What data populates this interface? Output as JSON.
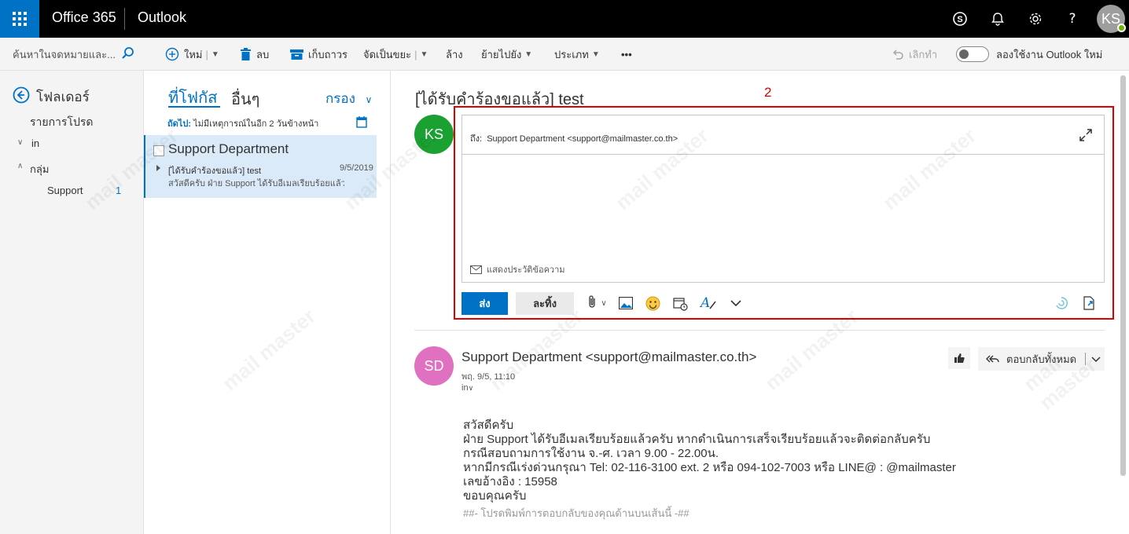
{
  "topbar": {
    "brand": "Office 365",
    "app": "Outlook",
    "avatar_initials": "KS",
    "icons": [
      "waffle-icon",
      "skype-icon",
      "bell-icon",
      "gear-icon",
      "help-icon"
    ],
    "help_glyph": "?"
  },
  "search": {
    "placeholder": "ค้นหาในจดหมายและ..."
  },
  "toolbar": {
    "new": "ใหม่",
    "delete": "ลบ",
    "archive": "เก็บถาวร",
    "junk": "จัดเป็นขยะ",
    "sweep": "ล้าง",
    "move": "ย้ายไปยัง",
    "categorize": "ประเภท",
    "more": "•••",
    "undo": "เลิกทำ",
    "try_new": "ลองใช้งาน Outlook ใหม่"
  },
  "folders": {
    "header": "โฟลเดอร์",
    "favorites": "รายการโปรด",
    "inbox": "in",
    "groups": "กลุ่ม",
    "group_items": [
      {
        "label": "Support",
        "count": "1"
      }
    ]
  },
  "message_list": {
    "tab_focused": "ที่โฟกัส",
    "tab_other": "อื่นๆ",
    "filter": "กรอง",
    "next_label": "ถัดไป:",
    "next_text": "ไม่มีเหตุการณ์ในอีก 2 วันข้างหน้า",
    "items": [
      {
        "sender": "Support Department",
        "subject": "[ได้รับคำร้องขอแล้ว] test",
        "date": "9/5/2019",
        "preview": "สวัสดีครับ  ฝ่าย Support ได้รับอีเมลเรียบร้อยแล้วครับ"
      }
    ]
  },
  "reading": {
    "subject": "[ได้รับคำร้องขอแล้ว] test",
    "annotation_number": "2",
    "compose": {
      "avatar_initials": "KS",
      "to_label": "ถึง:",
      "to_value": "Support Department <support@mailmaster.co.th>",
      "show_history": "แสดงประวัติข้อความ",
      "send": "ส่ง",
      "discard": "ละทิ้ง"
    },
    "message": {
      "avatar_initials": "SD",
      "from": "Support Department <support@mailmaster.co.th>",
      "date": "พฤ. 9/5, 11:10",
      "folder": "in",
      "reply_all": "ตอบกลับทั้งหมด",
      "body": "สวัสดีครับ\nฝ่าย Support ได้รับอีเมลเรียบร้อยแล้วครับ หากดำเนินการเสร็จเรียบร้อยแล้วจะติดต่อกลับครับ\nกรณีสอบถามการใช้งาน จ.-ศ. เวลา 9.00 - 22.00น.\nหากมีกรณีเร่งด่วนกรุณา Tel: 02-116-3100 ext. 2 หรือ 094-102-7003 หรือ LINE@ : @mailmaster\nเลขอ้างอิง : 15958\nขอบคุณครับ",
      "footer": "##- โปรดพิมพ์การตอบกลับของคุณด้านบนเส้นนี้ -##"
    }
  },
  "colors": {
    "accent": "#0072c6",
    "annotation": "#e00000",
    "ks_avatar": "#1ba132",
    "sd_avatar": "#e070c0",
    "selected_row": "#dbeaf8"
  }
}
